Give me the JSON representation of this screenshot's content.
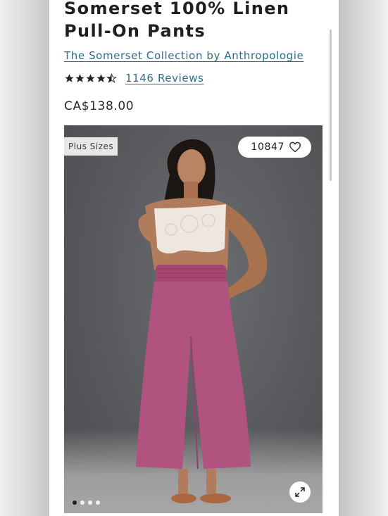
{
  "product": {
    "title": "Somerset 100% Linen Pull-On Pants",
    "brand": "The Somerset Collection by Anthropologie",
    "rating": 4.5,
    "reviews_label": "1146 Reviews",
    "price": "CA$138.00"
  },
  "gallery": {
    "badge": "Plus Sizes",
    "favorites_count": "10847",
    "slide_count": 4,
    "active_slide": 0
  },
  "icons": {
    "heart": "heart-outline-icon",
    "expand": "expand-arrows-icon",
    "star": "star-icon"
  },
  "colors": {
    "brand_link": "#2c6f86",
    "text": "#1f1f1f",
    "pants": "#b0537e",
    "photo_bg": "#58595c"
  }
}
